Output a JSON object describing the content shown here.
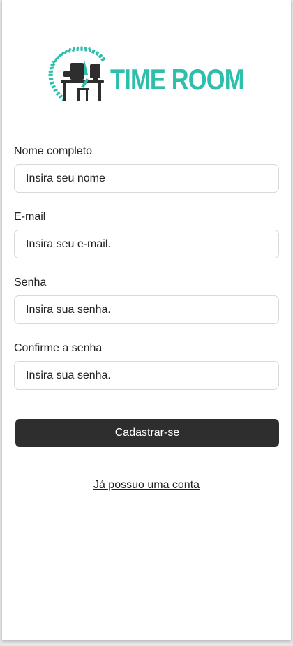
{
  "logo": {
    "text": "TIME ROOM",
    "color": "#2dbfac",
    "icon": "desk-clock-logo-icon"
  },
  "form": {
    "fields": [
      {
        "label": "Nome completo",
        "placeholder": "Insira seu nome"
      },
      {
        "label": "E-mail",
        "placeholder": "Insira seu e-mail."
      },
      {
        "label": "Senha",
        "placeholder": "Insira sua senha."
      },
      {
        "label": "Confirme a senha",
        "placeholder": "Insira sua senha."
      }
    ],
    "submit_label": "Cadastrar-se",
    "login_link": "Já possuo uma conta"
  },
  "colors": {
    "accent": "#2dbfac",
    "button_bg": "#2e2e2e",
    "button_text": "#ffffff"
  }
}
